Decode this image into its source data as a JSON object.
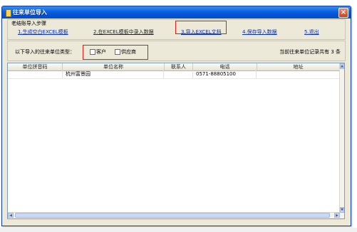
{
  "window": {
    "title": "往来单位导入",
    "close": "×"
  },
  "steps": {
    "title": "老结账导入步骤",
    "items": [
      {
        "label": "1.生成空白EXCEL模板",
        "style": "link"
      },
      {
        "label": "2.在EXCEL模板中录入数据",
        "style": "plain"
      },
      {
        "label": "3.导入EXCEL文档",
        "style": "link"
      },
      {
        "label": "4.保存导入数据",
        "style": "link"
      },
      {
        "label": "5.退出",
        "style": "link"
      }
    ]
  },
  "filter": {
    "label": "以下导入的往来单位类型：",
    "options": [
      {
        "label": "客户",
        "checked": false
      },
      {
        "label": "供应商",
        "checked": false
      }
    ],
    "count_text": "当前往来单位记录共有 3 条"
  },
  "grid": {
    "columns": [
      "单位拼音码",
      "单位名称",
      "联系人",
      "电话",
      "地址"
    ],
    "rows": [
      [
        "",
        "杭州富景园",
        "",
        "0571-88805100",
        ""
      ]
    ]
  },
  "colors": {
    "title_bar": "#0a5fe0",
    "highlight": "#e21c1c",
    "link": "#0b2fb5"
  }
}
